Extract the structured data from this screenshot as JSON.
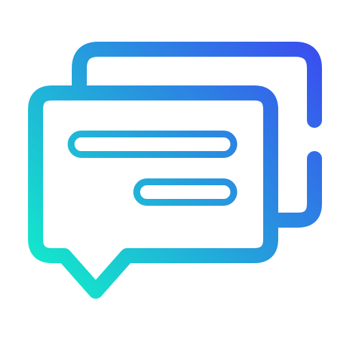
{
  "icon": {
    "name": "chat-bubbles-icon",
    "colors": {
      "gradient_start": "#10F2C9",
      "gradient_end": "#3A4DF0",
      "background": "#FFFFFF"
    }
  }
}
